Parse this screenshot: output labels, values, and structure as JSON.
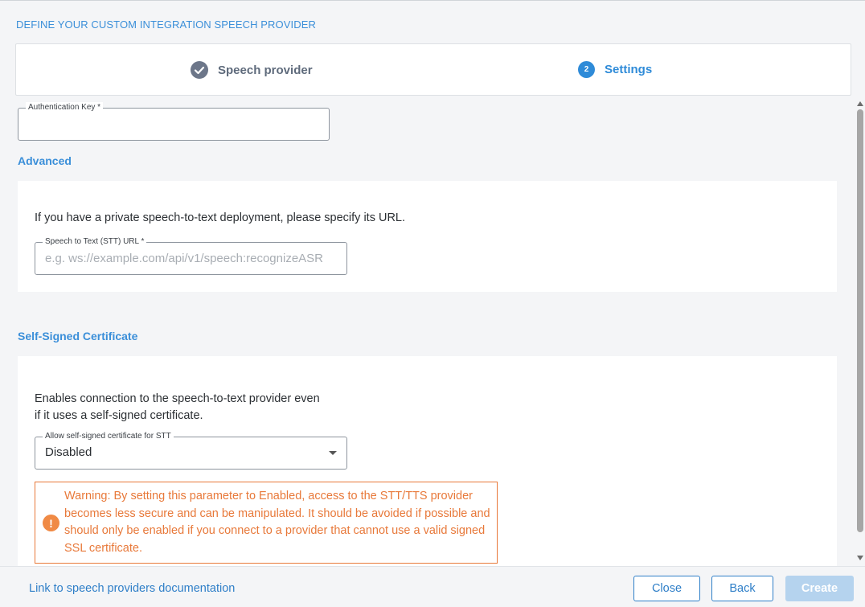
{
  "page": {
    "heading": "DEFINE YOUR CUSTOM INTEGRATION SPEECH PROVIDER"
  },
  "stepper": {
    "steps": [
      {
        "label": "Speech provider",
        "state": "completed",
        "icon": "check-circle-icon"
      },
      {
        "label": "Settings",
        "number": "2",
        "state": "current"
      }
    ]
  },
  "auth_key": {
    "label": "Authentication Key *",
    "value": ""
  },
  "advanced": {
    "title": "Advanced",
    "description": "If you have a private speech-to-text deployment, please specify its URL.",
    "stt_url": {
      "label": "Speech to Text (STT) URL *",
      "placeholder": "e.g.  ws://example.com/api/v1/speech:recognizeASR",
      "value": ""
    }
  },
  "certificate": {
    "title": "Self-Signed Certificate",
    "description_line1": "Enables connection to the speech-to-text provider even",
    "description_line2": "if it uses a self-signed certificate.",
    "select": {
      "label": "Allow self-signed certificate for STT",
      "value": "Disabled"
    },
    "warning": {
      "icon": "exclamation-icon",
      "text": "Warning: By setting this parameter to Enabled, access to the STT/TTS provider becomes less secure and can be manipulated. It should be avoided if possible and should only be enabled if you connect to a provider that cannot use a valid signed SSL certificate."
    }
  },
  "footer": {
    "doc_link": "Link to speech providers documentation",
    "close_label": "Close",
    "back_label": "Back",
    "create_label": "Create"
  },
  "colors": {
    "accent": "#2f8bd8",
    "warning": "#e8793a",
    "disabled_button": "#b5d3ee"
  }
}
